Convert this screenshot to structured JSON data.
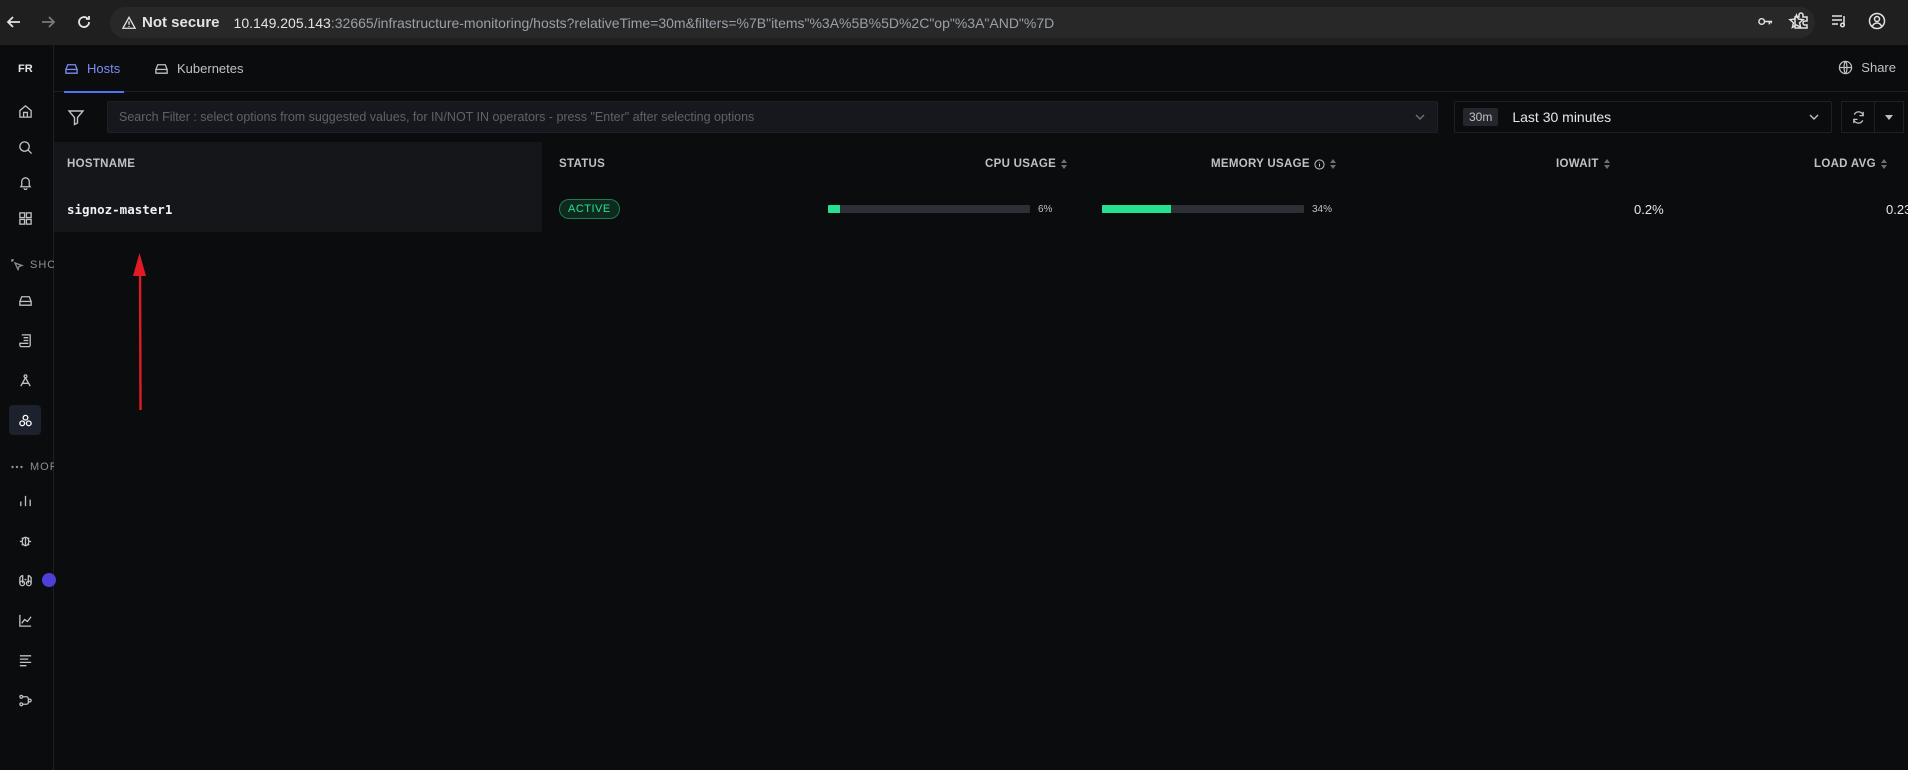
{
  "browser": {
    "security_label": "Not secure",
    "url_host": "10.149.205.143",
    "url_rest": ":32665/infrastructure-monitoring/hosts?relativeTime=30m&filters=%7B\"items\"%3A%5B%5D%2C\"op\"%3A\"AND\"%7D"
  },
  "sidebar": {
    "org_initials": "FR",
    "section_shortcuts": "SHORTCUTS",
    "section_more": "MORE"
  },
  "tabs": [
    {
      "label": "Hosts"
    },
    {
      "label": "Kubernetes"
    }
  ],
  "share_label": "Share",
  "search": {
    "placeholder": "Search Filter : select options from suggested values, for IN/NOT IN operators - press \"Enter\" after selecting options"
  },
  "time": {
    "chip": "30m",
    "label": "Last 30 minutes"
  },
  "table": {
    "headers": {
      "hostname": "HOSTNAME",
      "status": "STATUS",
      "cpu": "CPU USAGE",
      "memory": "MEMORY USAGE",
      "iowait": "IOWAIT",
      "load": "LOAD AVG"
    },
    "rows": [
      {
        "hostname": "signoz-master1",
        "status": "ACTIVE",
        "cpu_label": "6%",
        "cpu_fraction": 0.06,
        "memory_label": "34%",
        "memory_fraction": 0.34,
        "iowait": "0.2%",
        "load_avg": "0.23"
      }
    ]
  },
  "colors": {
    "accent": "#4e74f8",
    "success": "#25e192",
    "annotation": "#e01b24"
  }
}
